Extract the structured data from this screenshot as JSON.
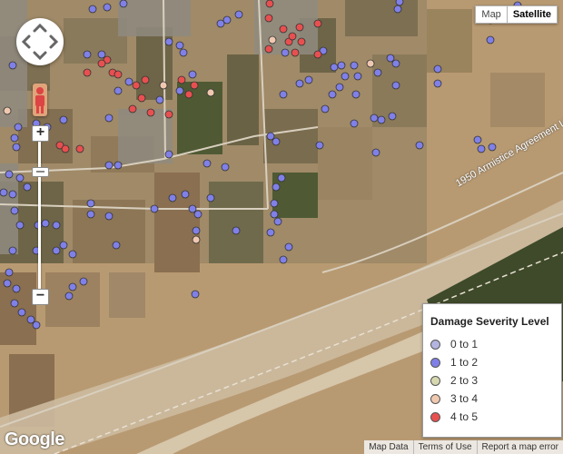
{
  "map_type": {
    "map_label": "Map",
    "satellite_label": "Satellite",
    "active": "Satellite"
  },
  "road_label": "1950 Armistice Agreement Line",
  "legend": {
    "title": "Damage Severity Level",
    "items": [
      {
        "label": "0 to 1",
        "color": "#b4b4e0"
      },
      {
        "label": "1 to 2",
        "color": "#8080e8"
      },
      {
        "label": "2 to 3",
        "color": "#d8d8b0"
      },
      {
        "label": "3 to 4",
        "color": "#f0c8b0"
      },
      {
        "label": "4 to 5",
        "color": "#e85050"
      }
    ]
  },
  "logo_text": "Google",
  "attribution": {
    "map_data": "Map Data",
    "terms": "Terms of Use",
    "report": "Report a map error"
  },
  "colors": {
    "terrain": "#b89a72",
    "river_bed": "#cdbba0",
    "field_dark": "#6e6548",
    "field_green": "#4f5a34",
    "village": "#8f8b80"
  }
}
